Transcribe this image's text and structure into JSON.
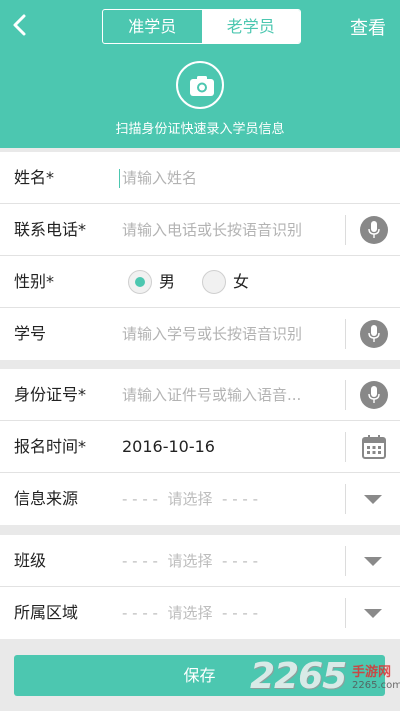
{
  "header": {
    "tabs": [
      {
        "label": "准学员",
        "active": false
      },
      {
        "label": "老学员",
        "active": true
      }
    ],
    "view_label": "查看",
    "scan_tip": "扫描身份证快速录入学员信息"
  },
  "form": {
    "name": {
      "label": "姓名*",
      "placeholder": "请输入姓名"
    },
    "phone": {
      "label": "联系电话*",
      "placeholder": "请输入电话或长按语音识别"
    },
    "gender": {
      "label": "性别*",
      "options": [
        "男",
        "女"
      ],
      "selected": "男"
    },
    "student_no": {
      "label": "学号",
      "placeholder": "请输入学号或长按语音识别"
    },
    "id_no": {
      "label": "身份证号*",
      "placeholder": "请输入证件号或输入语音..."
    },
    "enroll_time": {
      "label": "报名时间*",
      "value": "2016-10-16"
    },
    "source": {
      "label": "信息来源",
      "placeholder": "- - - -  请选择  - - - -"
    },
    "class": {
      "label": "班级",
      "placeholder": "- - - -  请选择  - - - -"
    },
    "region": {
      "label": "所属区域",
      "placeholder": "- - - -  请选择  - - - -"
    }
  },
  "save_label": "保存",
  "watermark": {
    "number": "2265",
    "site_cn": "手游网",
    "url": "2265.com"
  },
  "colors": {
    "accent": "#4cc7b0",
    "background": "#e9e9e9"
  },
  "icons": [
    "back-arrow-icon",
    "camera-icon",
    "microphone-icon",
    "calendar-icon",
    "dropdown-triangle-icon"
  ]
}
